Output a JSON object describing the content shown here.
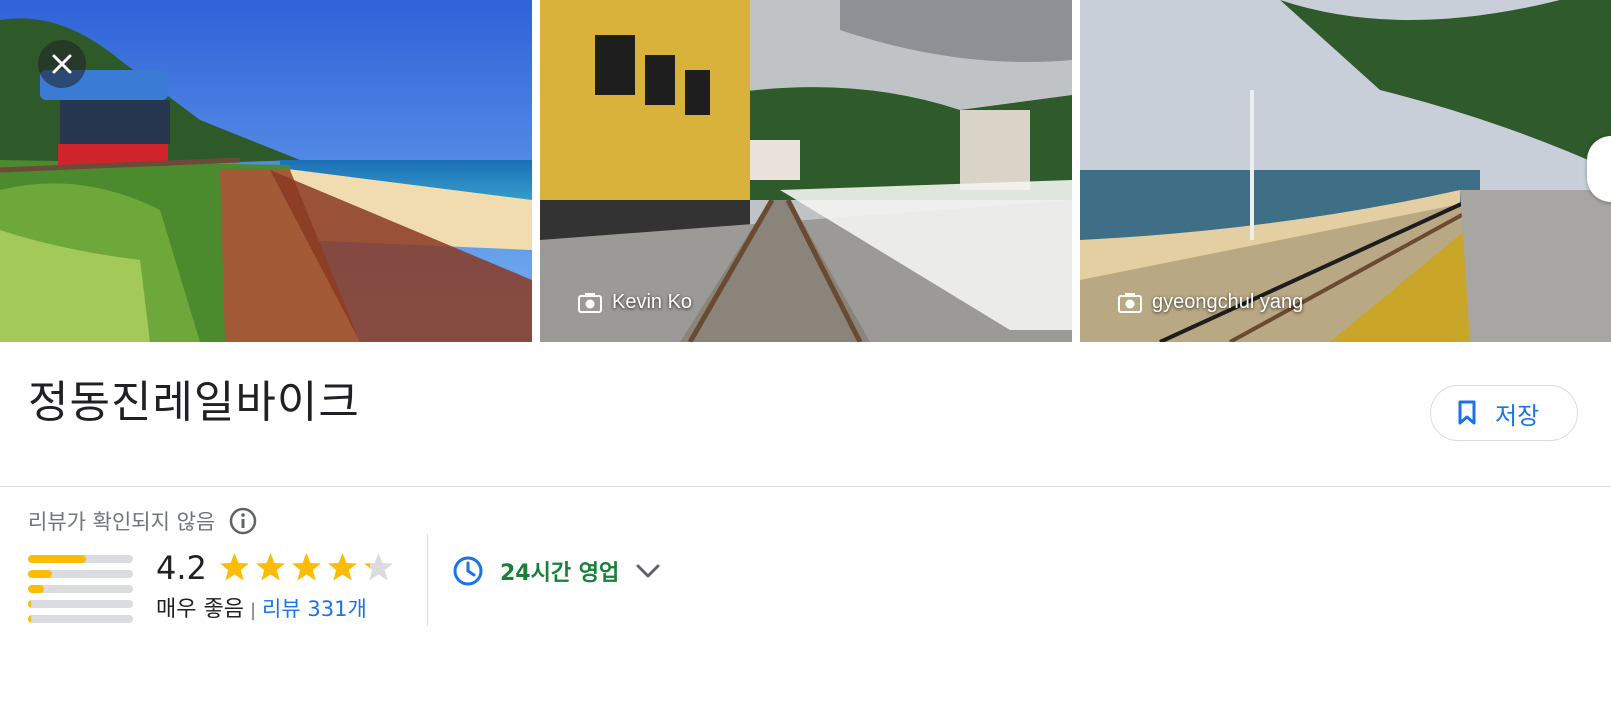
{
  "gallery": {
    "photos": [
      {
        "icon": "camera-icon",
        "credit": ""
      },
      {
        "icon": "camera-icon",
        "credit": "Kevin Ko"
      },
      {
        "icon": "camera-icon",
        "credit": "gyeongchul yang"
      }
    ]
  },
  "place": {
    "name": "정동진레일바이크",
    "save_label": "저장"
  },
  "reviews": {
    "note": "리뷰가 확인되지 않음",
    "rating": "4.2",
    "rating_value": 4.2,
    "rating_label": "매우 좋음",
    "separator": "|",
    "count_label": "리뷰 331개",
    "distribution": [
      0.55,
      0.23,
      0.15,
      0.03,
      0.03
    ]
  },
  "hours": {
    "status": "24시간 영업"
  },
  "colors": {
    "star": "#fbbc04",
    "accent": "#1a73e8",
    "open": "#188038"
  }
}
